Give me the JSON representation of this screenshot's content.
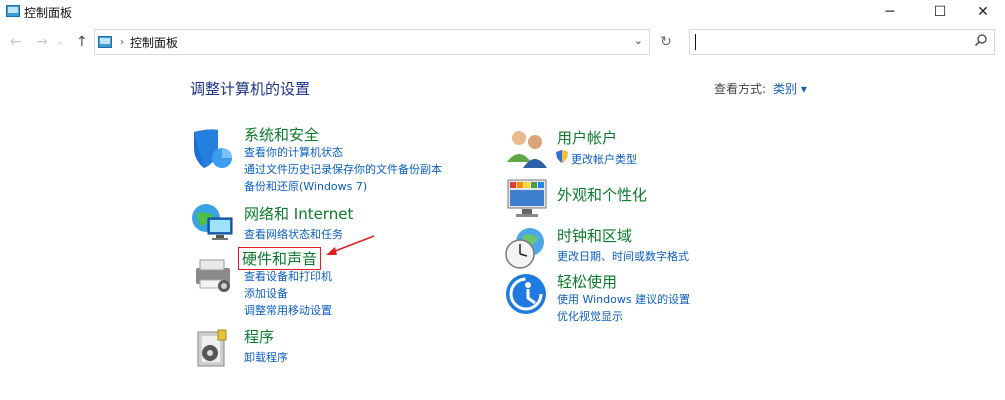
{
  "window": {
    "title": "控制面板",
    "minimize": "─",
    "maximize": "☐",
    "close": "✕"
  },
  "nav": {
    "back": "←",
    "forward": "→",
    "up": "↑"
  },
  "address": {
    "crumb": "控制面板",
    "separator": "›",
    "dropdown": "⌄",
    "refresh": "↻"
  },
  "search": {
    "placeholder": "",
    "icon": "search-icon"
  },
  "main": {
    "heading": "调整计算机的设置",
    "view_by_label": "查看方式:",
    "view_by_value": "类别 ▾"
  },
  "categories": {
    "system": {
      "title": "系统和安全",
      "links": [
        "查看你的计算机状态",
        "通过文件历史记录保存你的文件备份副本",
        "备份和还原(Windows 7)"
      ]
    },
    "network": {
      "title": "网络和 Internet",
      "links": [
        "查看网络状态和任务"
      ]
    },
    "hardware": {
      "title": "硬件和声音",
      "links": [
        "查看设备和打印机",
        "添加设备",
        "调整常用移动设置"
      ]
    },
    "programs": {
      "title": "程序",
      "links": [
        "卸载程序"
      ]
    },
    "users": {
      "title": "用户帐户",
      "links": [
        "更改帐户类型"
      ]
    },
    "appearance": {
      "title": "外观和个性化",
      "links": []
    },
    "clock": {
      "title": "时钟和区域",
      "links": [
        "更改日期、时间或数字格式"
      ]
    },
    "ease": {
      "title": "轻松使用",
      "links": [
        "使用 Windows 建议的设置",
        "优化视觉显示"
      ]
    }
  },
  "colors": {
    "heading": "#1e3287",
    "category_title": "#0a7a2c",
    "link": "#0b5fc1",
    "annotation": "#e02020"
  }
}
